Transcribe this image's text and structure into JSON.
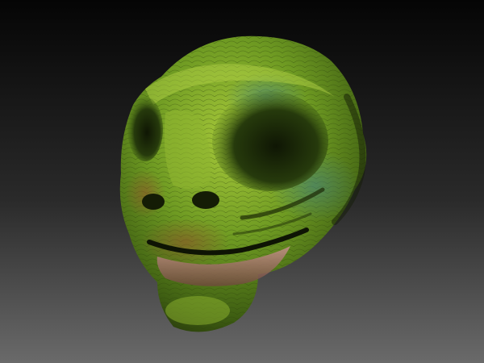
{
  "scene": {
    "subject": "sculpted-creature-head",
    "background": {
      "top_color": "#050505",
      "bottom_color": "#6a6a6a"
    },
    "skin": {
      "base": "#5a8a1a",
      "highlight": "#a7c93a",
      "shadow": "#1f2a08",
      "accent_blue": "#3f7f86",
      "accent_red": "#9a4a2a",
      "lip": "#b07a78"
    }
  }
}
